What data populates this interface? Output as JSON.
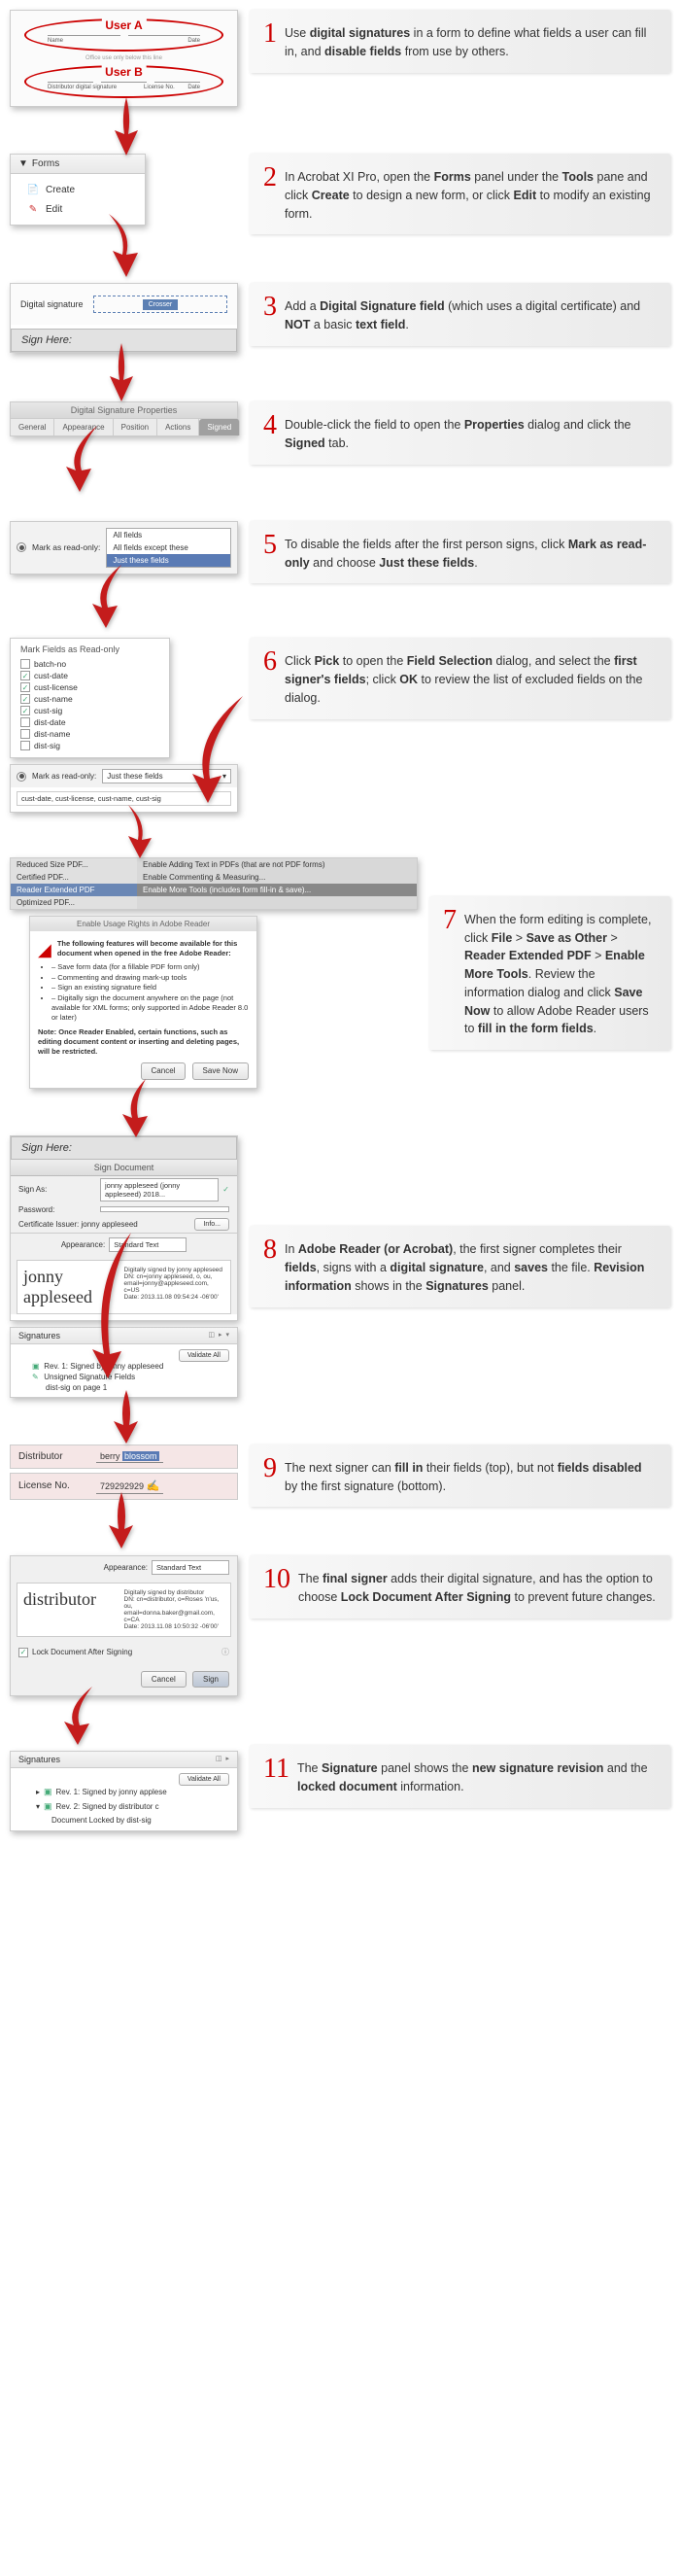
{
  "steps": [
    {
      "n": "1",
      "text": "Use <b>digital signatures</b> in a form to define what fields a user can fill in, and <b>disable fields</b> from use by others."
    },
    {
      "n": "2",
      "text": "In Acrobat XI Pro, open the <b>Forms</b> panel under the <b>Tools</b> pane and click <b>Create</b> to design a new form, or click <b>Edit</b> to modify an existing form."
    },
    {
      "n": "3",
      "text": "Add a <b>Digital Signature field</b> (which uses a digital certificate) and <b>NOT</b> a basic <b>text field</b>."
    },
    {
      "n": "4",
      "text": "Double-click the field to open the <b>Properties</b> dialog and click the <b>Signed</b> tab."
    },
    {
      "n": "5",
      "text": "To disable the fields after the first person signs, click <b>Mark as read-only</b> and choose <b>Just these fields</b>."
    },
    {
      "n": "6",
      "text": "Click <b>Pick</b> to open the <b>Field Selection</b> dialog, and select the <b>first signer's fields</b>; click <b>OK</b> to review the list of excluded fields on the dialog."
    },
    {
      "n": "7",
      "text": "When the form editing is complete, click <b>File</b> > <b>Save as Other</b> > <b>Reader Extended PDF</b> > <b>Enable More Tools</b>. Review the information dialog and click <b>Save Now</b> to allow Adobe Reader users to <b>fill in the form fields</b>."
    },
    {
      "n": "8",
      "text": "In <b>Adobe Reader (or Acrobat)</b>, the first signer completes their <b>fields</b>, signs with a <b>digital signature</b>, and <b>saves</b> the file. <b>Revision information</b> shows in the <b>Signatures</b> panel."
    },
    {
      "n": "9",
      "text": "The next signer can <b>fill in</b> their fields (top), but not <b>fields disabled</b> by the first signature (bottom)."
    },
    {
      "n": "10",
      "text": "The <b>final signer</b> adds their digital signature, and has the option to choose <b>Lock Document After Signing</b> to prevent future changes."
    },
    {
      "n": "11",
      "text": "The <b>Signature</b> panel shows the <b>new signature revision</b> and the <b>locked document</b> information."
    }
  ],
  "s1": {
    "userA": "User A",
    "userB": "User B",
    "tiny": "Office use only below this line",
    "lbls": [
      "Name",
      "Date",
      "License No."
    ]
  },
  "s2": {
    "hdr": "Forms",
    "create": "Create",
    "edit": "Edit"
  },
  "s3": {
    "ds": "Digital signature",
    "badge": "Crosser",
    "sh": "Sign Here:"
  },
  "s4": {
    "title": "Digital Signature Properties",
    "tabs": [
      "General",
      "Appearance",
      "Position",
      "Actions",
      "Signed"
    ]
  },
  "s5": {
    "mark": "Mark as read-only:",
    "opts": [
      "All fields",
      "All fields except these",
      "Just these fields"
    ]
  },
  "s6": {
    "title": "Mark Fields as Read-only",
    "items": [
      {
        "c": false,
        "t": "batch-no"
      },
      {
        "c": true,
        "t": "cust-date"
      },
      {
        "c": true,
        "t": "cust-license"
      },
      {
        "c": true,
        "t": "cust-name"
      },
      {
        "c": true,
        "t": "cust-sig"
      },
      {
        "c": false,
        "t": "dist-date"
      },
      {
        "c": false,
        "t": "dist-name"
      },
      {
        "c": false,
        "t": "dist-sig"
      }
    ],
    "mark": "Mark as read-only:",
    "sel": "Just these fields",
    "picked": "cust-date, cust-license, cust-name, cust-sig"
  },
  "s7": {
    "leftMenu": [
      "Reduced Size PDF...",
      "Certified PDF...",
      "Reader Extended PDF",
      "Optimized PDF..."
    ],
    "rightMenu": [
      "Enable Adding Text in PDFs (that are not PDF forms)",
      "Enable Commenting & Measuring...",
      "Enable More Tools (includes form fill-in & save)..."
    ],
    "infoHdr": "Enable Usage Rights in Adobe Reader",
    "intro": "The following features will become available for this document when opened in the free Adobe Reader:",
    "bullets": [
      "Save form data (for a fillable PDF form only)",
      "Commenting and drawing mark-up tools",
      "Sign an existing signature field",
      "Digitally sign the document anywhere on the page (not available for XML forms; only supported in Adobe Reader 8.0 or later)"
    ],
    "note": "Note: Once Reader Enabled, certain functions, such as editing document content or inserting and deleting pages, will be restricted.",
    "cancel": "Cancel",
    "save": "Save Now"
  },
  "s8": {
    "sh": "Sign Here:",
    "title": "Sign Document",
    "signas": "Sign As:",
    "signasv": "jonny appleseed (jonny appleseed) 2018...",
    "pwd": "Password:",
    "cert": "Certificate Issuer: jonny appleseed",
    "info": "Info...",
    "app": "Appearance:",
    "appv": "Standard Text",
    "sigName": "jonny appleseed",
    "sigMeta": "Digitally signed by jonny appleseed\nDN: cn=jonny appleseed, o, ou, email=jonny@appleseed.com, c=US\nDate: 2013.11.08 09:54:24 -06'00'",
    "panelTitle": "Signatures",
    "validate": "Validate All",
    "rev": "Rev. 1: Signed by jonny appleseed",
    "unsigned": "Unsigned Signature Fields",
    "page": "dist-sig on page 1"
  },
  "s9": {
    "dist": "Distributor",
    "distv1": "berry ",
    "distv2": "blossom",
    "lic": "License No.",
    "licv": "729292929"
  },
  "s10": {
    "app": "Appearance:",
    "appv": "Standard Text",
    "sigName": "distributor",
    "sigMeta": "Digitally signed by distributor\nDN: cn=distributor, o=Roses 'n'us, ou, email=donna.baker@gmail.com, c=CA\nDate: 2013.11.08 10:50:32 -06'00'",
    "lock": "Lock Document After Signing",
    "cancel": "Cancel",
    "sign": "Sign"
  },
  "s11": {
    "title": "Signatures",
    "validate": "Validate All",
    "r1": "Rev. 1: Signed by jonny applese",
    "r2": "Rev. 2: Signed by distributor c",
    "locked": "Document Locked by dist-sig"
  }
}
